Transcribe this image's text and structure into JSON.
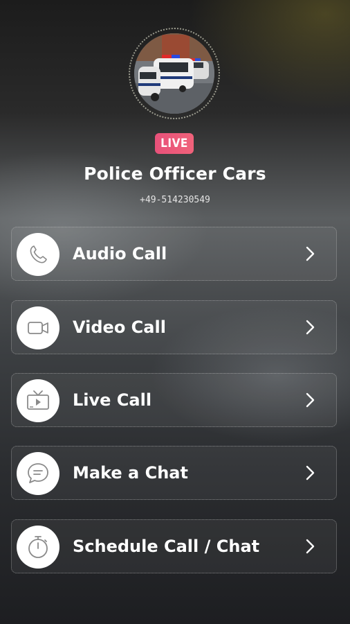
{
  "profile": {
    "badge": "LIVE",
    "name": "Police Officer Cars",
    "phone": "+49-514230549"
  },
  "menu": {
    "items": [
      {
        "label": "Audio Call",
        "icon": "phone-icon"
      },
      {
        "label": "Video Call",
        "icon": "video-camera-icon"
      },
      {
        "label": "Live Call",
        "icon": "tv-icon"
      },
      {
        "label": "Make a Chat",
        "icon": "chat-bubble-icon"
      },
      {
        "label": "Schedule Call / Chat",
        "icon": "stopwatch-icon"
      }
    ]
  },
  "colors": {
    "badge": "#e8517a",
    "icon": "#8a8a8a"
  }
}
